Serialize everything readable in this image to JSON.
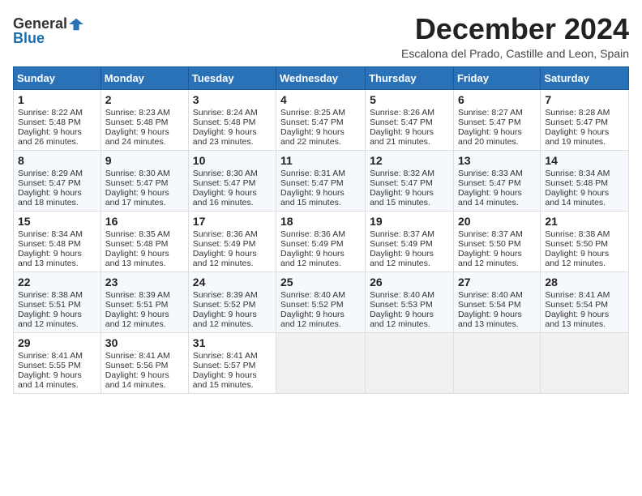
{
  "logo": {
    "general": "General",
    "blue": "Blue"
  },
  "title": "December 2024",
  "subtitle": "Escalona del Prado, Castille and Leon, Spain",
  "weekdays": [
    "Sunday",
    "Monday",
    "Tuesday",
    "Wednesday",
    "Thursday",
    "Friday",
    "Saturday"
  ],
  "weeks": [
    [
      {
        "day": "1",
        "sunrise": "Sunrise: 8:22 AM",
        "sunset": "Sunset: 5:48 PM",
        "daylight": "Daylight: 9 hours and 26 minutes."
      },
      {
        "day": "2",
        "sunrise": "Sunrise: 8:23 AM",
        "sunset": "Sunset: 5:48 PM",
        "daylight": "Daylight: 9 hours and 24 minutes."
      },
      {
        "day": "3",
        "sunrise": "Sunrise: 8:24 AM",
        "sunset": "Sunset: 5:48 PM",
        "daylight": "Daylight: 9 hours and 23 minutes."
      },
      {
        "day": "4",
        "sunrise": "Sunrise: 8:25 AM",
        "sunset": "Sunset: 5:47 PM",
        "daylight": "Daylight: 9 hours and 22 minutes."
      },
      {
        "day": "5",
        "sunrise": "Sunrise: 8:26 AM",
        "sunset": "Sunset: 5:47 PM",
        "daylight": "Daylight: 9 hours and 21 minutes."
      },
      {
        "day": "6",
        "sunrise": "Sunrise: 8:27 AM",
        "sunset": "Sunset: 5:47 PM",
        "daylight": "Daylight: 9 hours and 20 minutes."
      },
      {
        "day": "7",
        "sunrise": "Sunrise: 8:28 AM",
        "sunset": "Sunset: 5:47 PM",
        "daylight": "Daylight: 9 hours and 19 minutes."
      }
    ],
    [
      {
        "day": "8",
        "sunrise": "Sunrise: 8:29 AM",
        "sunset": "Sunset: 5:47 PM",
        "daylight": "Daylight: 9 hours and 18 minutes."
      },
      {
        "day": "9",
        "sunrise": "Sunrise: 8:30 AM",
        "sunset": "Sunset: 5:47 PM",
        "daylight": "Daylight: 9 hours and 17 minutes."
      },
      {
        "day": "10",
        "sunrise": "Sunrise: 8:30 AM",
        "sunset": "Sunset: 5:47 PM",
        "daylight": "Daylight: 9 hours and 16 minutes."
      },
      {
        "day": "11",
        "sunrise": "Sunrise: 8:31 AM",
        "sunset": "Sunset: 5:47 PM",
        "daylight": "Daylight: 9 hours and 15 minutes."
      },
      {
        "day": "12",
        "sunrise": "Sunrise: 8:32 AM",
        "sunset": "Sunset: 5:47 PM",
        "daylight": "Daylight: 9 hours and 15 minutes."
      },
      {
        "day": "13",
        "sunrise": "Sunrise: 8:33 AM",
        "sunset": "Sunset: 5:47 PM",
        "daylight": "Daylight: 9 hours and 14 minutes."
      },
      {
        "day": "14",
        "sunrise": "Sunrise: 8:34 AM",
        "sunset": "Sunset: 5:48 PM",
        "daylight": "Daylight: 9 hours and 14 minutes."
      }
    ],
    [
      {
        "day": "15",
        "sunrise": "Sunrise: 8:34 AM",
        "sunset": "Sunset: 5:48 PM",
        "daylight": "Daylight: 9 hours and 13 minutes."
      },
      {
        "day": "16",
        "sunrise": "Sunrise: 8:35 AM",
        "sunset": "Sunset: 5:48 PM",
        "daylight": "Daylight: 9 hours and 13 minutes."
      },
      {
        "day": "17",
        "sunrise": "Sunrise: 8:36 AM",
        "sunset": "Sunset: 5:49 PM",
        "daylight": "Daylight: 9 hours and 12 minutes."
      },
      {
        "day": "18",
        "sunrise": "Sunrise: 8:36 AM",
        "sunset": "Sunset: 5:49 PM",
        "daylight": "Daylight: 9 hours and 12 minutes."
      },
      {
        "day": "19",
        "sunrise": "Sunrise: 8:37 AM",
        "sunset": "Sunset: 5:49 PM",
        "daylight": "Daylight: 9 hours and 12 minutes."
      },
      {
        "day": "20",
        "sunrise": "Sunrise: 8:37 AM",
        "sunset": "Sunset: 5:50 PM",
        "daylight": "Daylight: 9 hours and 12 minutes."
      },
      {
        "day": "21",
        "sunrise": "Sunrise: 8:38 AM",
        "sunset": "Sunset: 5:50 PM",
        "daylight": "Daylight: 9 hours and 12 minutes."
      }
    ],
    [
      {
        "day": "22",
        "sunrise": "Sunrise: 8:38 AM",
        "sunset": "Sunset: 5:51 PM",
        "daylight": "Daylight: 9 hours and 12 minutes."
      },
      {
        "day": "23",
        "sunrise": "Sunrise: 8:39 AM",
        "sunset": "Sunset: 5:51 PM",
        "daylight": "Daylight: 9 hours and 12 minutes."
      },
      {
        "day": "24",
        "sunrise": "Sunrise: 8:39 AM",
        "sunset": "Sunset: 5:52 PM",
        "daylight": "Daylight: 9 hours and 12 minutes."
      },
      {
        "day": "25",
        "sunrise": "Sunrise: 8:40 AM",
        "sunset": "Sunset: 5:52 PM",
        "daylight": "Daylight: 9 hours and 12 minutes."
      },
      {
        "day": "26",
        "sunrise": "Sunrise: 8:40 AM",
        "sunset": "Sunset: 5:53 PM",
        "daylight": "Daylight: 9 hours and 12 minutes."
      },
      {
        "day": "27",
        "sunrise": "Sunrise: 8:40 AM",
        "sunset": "Sunset: 5:54 PM",
        "daylight": "Daylight: 9 hours and 13 minutes."
      },
      {
        "day": "28",
        "sunrise": "Sunrise: 8:41 AM",
        "sunset": "Sunset: 5:54 PM",
        "daylight": "Daylight: 9 hours and 13 minutes."
      }
    ],
    [
      {
        "day": "29",
        "sunrise": "Sunrise: 8:41 AM",
        "sunset": "Sunset: 5:55 PM",
        "daylight": "Daylight: 9 hours and 14 minutes."
      },
      {
        "day": "30",
        "sunrise": "Sunrise: 8:41 AM",
        "sunset": "Sunset: 5:56 PM",
        "daylight": "Daylight: 9 hours and 14 minutes."
      },
      {
        "day": "31",
        "sunrise": "Sunrise: 8:41 AM",
        "sunset": "Sunset: 5:57 PM",
        "daylight": "Daylight: 9 hours and 15 minutes."
      },
      null,
      null,
      null,
      null
    ]
  ]
}
